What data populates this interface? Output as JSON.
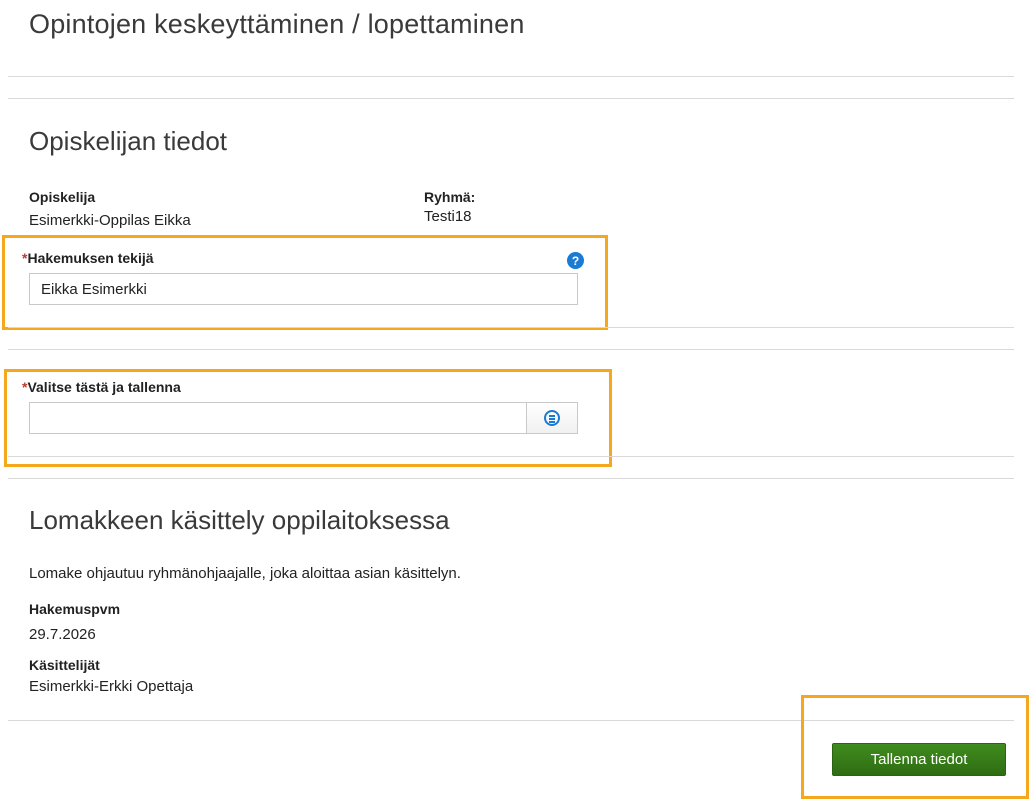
{
  "page": {
    "title": "Opintojen keskeyttäminen / lopettaminen"
  },
  "student_section": {
    "title": "Opiskelijan tiedot",
    "student_label": "Opiskelija",
    "student_value": "Esimerkki-Oppilas Eikka",
    "group_label": "Ryhmä:",
    "group_value": "Testi18"
  },
  "applicant": {
    "required_mark": "*",
    "label": "Hakemuksen tekijä",
    "value": "Eikka Esimerkki",
    "help_icon": "question-circle-icon",
    "help_glyph": "?"
  },
  "choice": {
    "required_mark": "*",
    "label": "Valitse tästä ja tallenna",
    "value": "",
    "picker_icon": "list-circle-icon"
  },
  "processing": {
    "title": "Lomakkeen käsittely oppilaitoksessa",
    "description": "Lomake ohjautuu ryhmänohjaajalle, joka aloittaa asian käsittelyn.",
    "date_label": "Hakemuspvm",
    "date_value": "29.7.2026",
    "handlers_label": "Käsittelijät",
    "handlers_value": "Esimerkki-Erkki Opettaja"
  },
  "actions": {
    "save_label": "Tallenna tiedot"
  },
  "colors": {
    "highlight": "#f5a81d",
    "save_button": "#3a7f1a",
    "required": "#c0392b",
    "icon_blue": "#1a7ad4"
  }
}
